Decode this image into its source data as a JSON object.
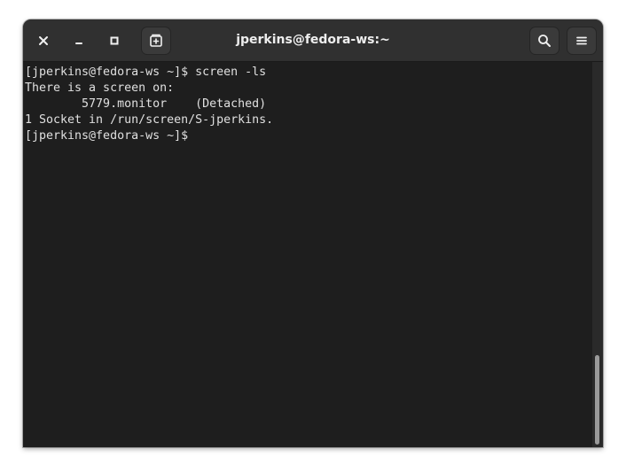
{
  "window": {
    "title": "jperkins@fedora-ws:~"
  },
  "headerbar": {
    "buttons": [
      {
        "icon": "close-icon"
      },
      {
        "icon": "minimize-icon"
      },
      {
        "icon": "maximize-icon"
      },
      {
        "icon": "new-tab-icon"
      },
      {
        "icon": "search-icon"
      },
      {
        "icon": "hamburger-menu-icon"
      }
    ]
  },
  "terminal": {
    "lines": [
      "[jperkins@fedora-ws ~]$ screen -ls",
      "There is a screen on:",
      "        5779.monitor    (Detached)",
      "1 Socket in /run/screen/S-jperkins.",
      "[jperkins@fedora-ws ~]$ "
    ],
    "colors": {
      "background": "#1e1e1e",
      "foreground": "#e0e0e0",
      "headerbar": "#303030"
    },
    "scroll_position": 1.0
  }
}
